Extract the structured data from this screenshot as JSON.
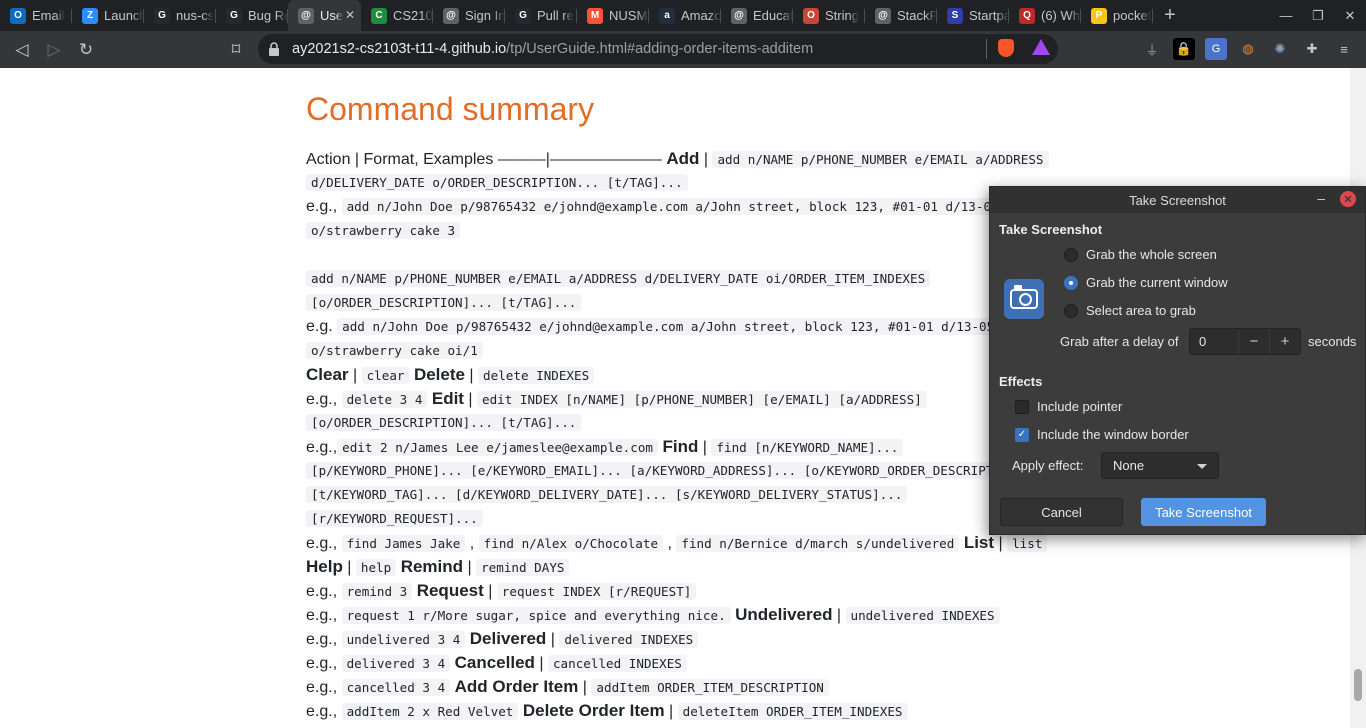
{
  "tabs": [
    {
      "label": "Email",
      "icon": "outlook-icon",
      "color": "#0f6cbd",
      "glyph": "O"
    },
    {
      "label": "Launch",
      "icon": "zoom-icon",
      "color": "#2d8cff",
      "glyph": "Z"
    },
    {
      "label": "nus-cs",
      "icon": "github-icon",
      "color": "#24292f",
      "glyph": "G"
    },
    {
      "label": "Bug Re",
      "icon": "github-icon",
      "color": "#24292f",
      "glyph": "G"
    },
    {
      "label": "Use",
      "icon": "globe-icon",
      "color": "#5f6368",
      "glyph": "@",
      "active": true
    },
    {
      "label": "CS2103",
      "icon": "grad-cap-icon",
      "color": "#1e8e3e",
      "glyph": "C"
    },
    {
      "label": "Sign In",
      "icon": "globe-icon",
      "color": "#5f6368",
      "glyph": "@"
    },
    {
      "label": "Pull re",
      "icon": "github-icon",
      "color": "#24292f",
      "glyph": "G"
    },
    {
      "label": "NUSMo",
      "icon": "nusmods-icon",
      "color": "#ff5138",
      "glyph": "M"
    },
    {
      "label": "Amazo",
      "icon": "amazon-icon",
      "color": "#232f3e",
      "glyph": "a"
    },
    {
      "label": "Educat",
      "icon": "globe-icon",
      "color": "#5f6368",
      "glyph": "@"
    },
    {
      "label": "String",
      "icon": "oracle-icon",
      "color": "#c74634",
      "glyph": "O"
    },
    {
      "label": "StackP",
      "icon": "globe-icon",
      "color": "#5f6368",
      "glyph": "@"
    },
    {
      "label": "Startpa",
      "icon": "startpage-icon",
      "color": "#2f3ea8",
      "glyph": "S"
    },
    {
      "label": "(6) Whe",
      "icon": "quora-icon",
      "color": "#b92b27",
      "glyph": "Q"
    },
    {
      "label": "pocket",
      "icon": "pocket-icon",
      "color": "#f5c518",
      "glyph": "P"
    }
  ],
  "window_controls": {
    "minimize": "—",
    "maximize": "❐",
    "close": "✕"
  },
  "toolbar": {
    "back": "◁",
    "forward": "▷",
    "reload": "↻",
    "bookmark": "⌑",
    "url_host": "ay2021s2-cs2103t-t11-4.github.io",
    "url_path": "/tp/UserGuide.html#adding-order-items-additem"
  },
  "doc": {
    "heading": "Command summary",
    "lines": [
      {
        "t": "Action | Format, Examples ———|——————— ",
        "b": "Add",
        "after": " | ",
        "code": [
          "add n/NAME p/PHONE_NUMBER e/EMAIL a/ADDRESS"
        ]
      },
      {
        "code": [
          "d/DELIVERY_DATE o/ORDER_DESCRIPTION... [t/TAG]..."
        ]
      },
      {
        "t": "e.g., ",
        "code": [
          "add n/John Doe p/98765432 e/johnd@example.com a/John street, block 123, #01-01 d/13-05"
        ]
      },
      {
        "code": [
          "o/strawberry cake 3"
        ]
      },
      {
        "t": ""
      },
      {
        "code": [
          "add n/NAME p/PHONE_NUMBER e/EMAIL a/ADDRESS d/DELIVERY_DATE oi/ORDER_ITEM_INDEXES"
        ]
      },
      {
        "code": [
          "[o/ORDER_DESCRIPTION]... [t/TAG]..."
        ]
      },
      {
        "t": "e.g. ",
        "code": [
          "add n/John Doe p/98765432 e/johnd@example.com a/John street, block 123, #01-01 d/13-05"
        ]
      },
      {
        "code": [
          "o/strawberry cake oi/1"
        ]
      },
      {
        "b": "Clear",
        "after": " | ",
        "code": [
          "clear"
        ],
        "b2": "Delete",
        "after2": " | ",
        "code2": [
          "delete INDEXES"
        ]
      },
      {
        "t": "e.g., ",
        "code": [
          "delete 3 4"
        ],
        "b2": "Edit",
        "after2": " | ",
        "code2": [
          "edit INDEX [n/NAME] [p/PHONE_NUMBER] [e/EMAIL] [a/ADDRESS]"
        ]
      },
      {
        "code": [
          "[o/ORDER_DESCRIPTION]... [t/TAG]..."
        ]
      },
      {
        "t": "e.g.,",
        "code": [
          "edit 2 n/James Lee e/jameslee@example.com"
        ],
        "b2": "Find",
        "after2": " | ",
        "code2": [
          "find [n/KEYWORD_NAME]..."
        ]
      },
      {
        "code": [
          "[p/KEYWORD_PHONE]... [e/KEYWORD_EMAIL]... [a/KEYWORD_ADDRESS]... [o/KEYWORD_ORDER_DESCRIPTI"
        ]
      },
      {
        "code": [
          "[t/KEYWORD_TAG]... [d/KEYWORD_DELIVERY_DATE]... [s/KEYWORD_DELIVERY_STATUS]..."
        ]
      },
      {
        "code": [
          "[r/KEYWORD_REQUEST]..."
        ]
      },
      {
        "t": "e.g., ",
        "code": [
          "find James Jake",
          "find n/Alex o/Chocolate",
          "find n/Bernice d/march s/undelivered"
        ],
        "b2": "List",
        "after2": " | ",
        "code2": [
          "list"
        ]
      },
      {
        "b": "Help",
        "after": " | ",
        "code": [
          "help"
        ],
        "b2": "Remind",
        "after2": " | ",
        "code2": [
          "remind DAYS"
        ]
      },
      {
        "t": "e.g., ",
        "code": [
          "remind 3"
        ],
        "b2": "Request",
        "after2": " | ",
        "code2": [
          "request INDEX [r/REQUEST]"
        ]
      },
      {
        "t": "e.g., ",
        "code": [
          "request 1 r/More sugar, spice and everything nice."
        ],
        "b2": "Undelivered",
        "after2": " | ",
        "code2": [
          "undelivered INDEXES"
        ]
      },
      {
        "t": "e.g., ",
        "code": [
          "undelivered 3 4"
        ],
        "b2": "Delivered",
        "after2": " | ",
        "code2": [
          "delivered INDEXES"
        ]
      },
      {
        "t": "e.g., ",
        "code": [
          "delivered 3 4"
        ],
        "b2": "Cancelled",
        "after2": " | ",
        "code2": [
          "cancelled INDEXES"
        ]
      },
      {
        "t": "e.g., ",
        "code": [
          "cancelled 3 4"
        ],
        "b2": "Add Order Item",
        "after2": " | ",
        "code2": [
          "addItem ORDER_ITEM_DESCRIPTION"
        ]
      },
      {
        "t": "e.g., ",
        "code": [
          "addItem 2 x Red Velvet"
        ],
        "b2": "Delete Order Item",
        "after2": " | ",
        "code2": [
          "deleteItem ORDER_ITEM_INDEXES"
        ]
      }
    ]
  },
  "dialog": {
    "title": "Take Screenshot",
    "minimize": "–",
    "close": "✕",
    "section_take": "Take Screenshot",
    "options": [
      {
        "label": "Grab the whole screen",
        "selected": false
      },
      {
        "label": "Grab the current window",
        "selected": true
      },
      {
        "label": "Select area to grab",
        "selected": false
      }
    ],
    "delay_label": "Grab after a delay of",
    "delay_value": "0",
    "delay_minus": "−",
    "delay_plus": "+",
    "delay_unit": "seconds",
    "section_effects": "Effects",
    "include_pointer": {
      "label": "Include pointer",
      "checked": false
    },
    "include_border": {
      "label": "Include the window border",
      "checked": true
    },
    "apply_effect_label": "Apply effect:",
    "apply_effect_value": "None",
    "cancel_label": "Cancel",
    "ok_label": "Take Screenshot",
    "accent": "#5294e2"
  }
}
